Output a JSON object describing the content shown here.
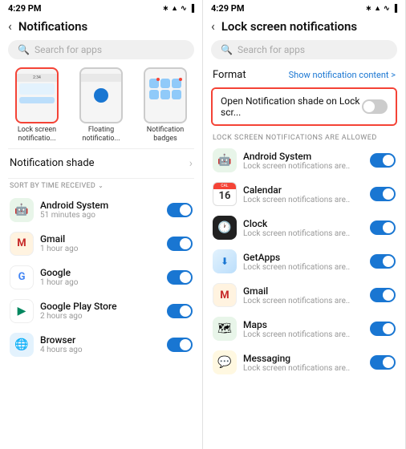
{
  "left": {
    "status": {
      "time": "4:29 PM"
    },
    "title": "Notifications",
    "search_placeholder": "Search for apps",
    "styles": [
      {
        "id": "lock",
        "label": "Lock screen\nnotificatio...",
        "selected": true
      },
      {
        "id": "floating",
        "label": "Floating\nnotificatio...",
        "selected": false
      },
      {
        "id": "badges",
        "label": "Notification\nbadges",
        "selected": false
      }
    ],
    "notification_shade": {
      "label": "Notification shade"
    },
    "sort_label": "SORT BY TIME RECEIVED",
    "apps": [
      {
        "id": "android",
        "name": "Android System",
        "time": "51 minutes ago",
        "icon": "🤖",
        "toggle": "on",
        "icon_class": "icon-android"
      },
      {
        "id": "gmail",
        "name": "Gmail",
        "time": "1 hour ago",
        "icon": "M",
        "toggle": "on",
        "icon_class": "icon-gmail"
      },
      {
        "id": "google",
        "name": "Google",
        "time": "1 hour ago",
        "icon": "G",
        "toggle": "on",
        "icon_class": "icon-google"
      },
      {
        "id": "play",
        "name": "Google Play Store",
        "time": "2 hours ago",
        "icon": "▶",
        "toggle": "on",
        "icon_class": "icon-play"
      },
      {
        "id": "browser",
        "name": "Browser",
        "time": "4 hours ago",
        "icon": "🌐",
        "toggle": "on",
        "icon_class": "icon-browser"
      }
    ]
  },
  "right": {
    "status": {
      "time": "4:29 PM"
    },
    "title": "Lock screen notifications",
    "search_placeholder": "Search for apps",
    "format_label": "Format",
    "format_link": "Show notification content  >",
    "open_notif_label": "Open Notification shade on Lock scr...",
    "open_notif_toggle": "off",
    "section_label": "LOCK SCREEN NOTIFICATIONS ARE ALLOWED",
    "apps": [
      {
        "id": "android",
        "name": "Android System",
        "sub": "Lock screen notifications are..",
        "toggle": "on",
        "icon": "🤖",
        "icon_class": "icon-android"
      },
      {
        "id": "calendar",
        "name": "Calendar",
        "sub": "Lock screen notifications are..",
        "toggle": "on"
      },
      {
        "id": "clock",
        "name": "Clock",
        "sub": "Lock screen notifications are..",
        "toggle": "on",
        "icon": "🕐",
        "icon_class": "icon-clock"
      },
      {
        "id": "getapps",
        "name": "GetApps",
        "sub": "Lock screen notifications are..",
        "toggle": "on",
        "icon": "↓",
        "icon_class": "icon-getapps"
      },
      {
        "id": "gmail",
        "name": "Gmail",
        "sub": "Lock screen notifications are..",
        "toggle": "on",
        "icon": "M",
        "icon_class": "icon-gmail"
      },
      {
        "id": "maps",
        "name": "Maps",
        "sub": "Lock screen notifications are..",
        "toggle": "on",
        "icon": "🗺",
        "icon_class": "icon-maps"
      },
      {
        "id": "messaging",
        "name": "Messaging",
        "sub": "Lock screen notifications are..",
        "toggle": "on",
        "icon": "💬",
        "icon_class": "icon-messaging"
      }
    ]
  }
}
